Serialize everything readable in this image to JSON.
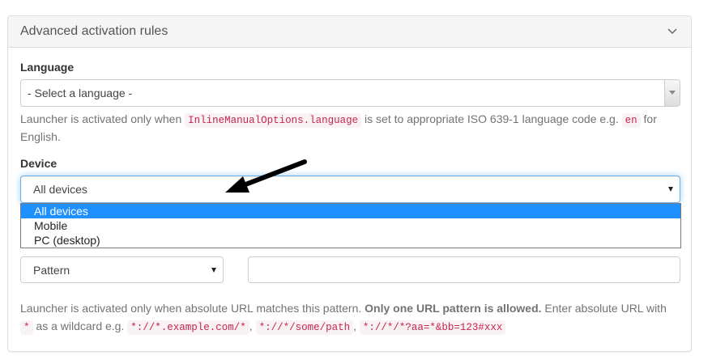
{
  "panel": {
    "title": "Advanced activation rules"
  },
  "language": {
    "label": "Language",
    "selected": "- Select a language -",
    "help_before": "Launcher is activated only when ",
    "help_code1": "InlineManualOptions.language",
    "help_middle": " is set to appropriate ISO 639-1 language code e.g. ",
    "help_code2": "en",
    "help_after": " for",
    "help_line2": "English."
  },
  "device": {
    "label": "Device",
    "selected": "All devices",
    "options": [
      "All devices",
      "Mobile",
      "PC (desktop)"
    ]
  },
  "url": {
    "match_type": "Pattern",
    "value": "",
    "help_part1": "Launcher is activated only when absolute URL matches this pattern. ",
    "help_bold": "Only one URL pattern is allowed.",
    "help_part2": " Enter absolute URL with",
    "help_code_wild": "*",
    "help_part3": " as a wildcard e.g. ",
    "example1": "*://*.example.com/*",
    "sep1": ", ",
    "example2": "*://*/some/path",
    "sep2": ", ",
    "example3": "*://*/*?aa=*&bb=123#xxx"
  },
  "colors": {
    "selected_option_bg": "#1e90ff",
    "code_text": "#c7254e",
    "focus_border": "#66afe9"
  }
}
